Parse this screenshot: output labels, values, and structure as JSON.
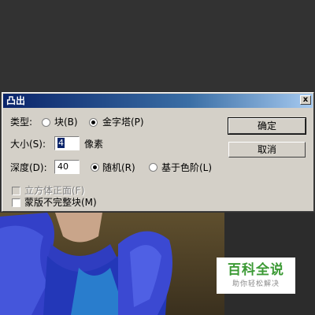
{
  "dialog": {
    "title": "凸出",
    "close_glyph": "x",
    "type_label": "类型:",
    "type_options": [
      {
        "label": "块(B)",
        "checked": false
      },
      {
        "label": "金字塔(P)",
        "checked": true
      }
    ],
    "size_label": "大小(S):",
    "size_value": "4",
    "size_unit": "像素",
    "depth_label": "深度(D):",
    "depth_value": "40",
    "depth_options": [
      {
        "label": "随机(R)",
        "checked": true
      },
      {
        "label": "基于色阶(L)",
        "checked": false
      }
    ],
    "solid_front_faces": {
      "label": "立方体正面(F)",
      "checked": false,
      "disabled": true
    },
    "mask_incomplete": {
      "label": "蒙版不完整块(M)",
      "checked": false
    },
    "ok_label": "确定",
    "cancel_label": "取消"
  },
  "watermark": {
    "title": "百科全说",
    "subtitle": "助你轻松解决"
  },
  "colors": {
    "titlebar_start": "#0a246a",
    "titlebar_end": "#a6caf0",
    "dialog_bg": "#d4d0c8",
    "watermark_green": "#3c9a35"
  }
}
